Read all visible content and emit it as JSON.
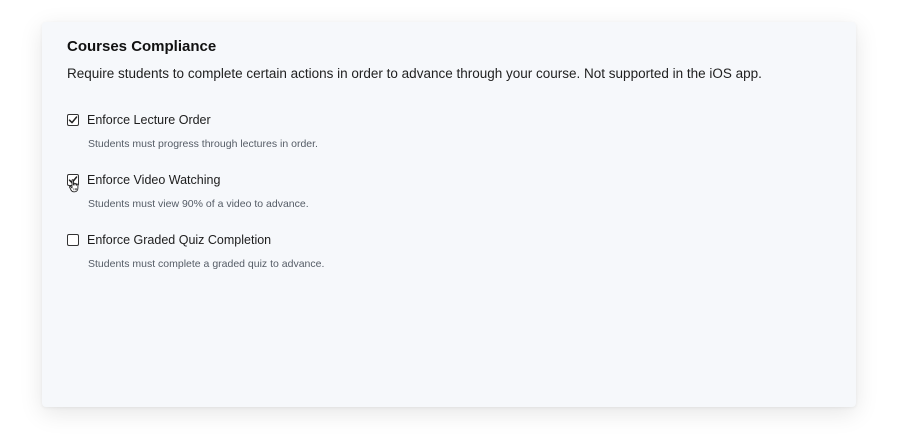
{
  "compliance": {
    "title": "Courses Compliance",
    "description": "Require students to complete certain actions in order to advance through your course. Not supported in the iOS app.",
    "options": [
      {
        "label": "Enforce Lecture Order",
        "help": "Students must progress through lectures in order.",
        "checked": true
      },
      {
        "label": "Enforce Video Watching",
        "help": "Students must view 90% of a video to advance.",
        "checked": true
      },
      {
        "label": "Enforce Graded Quiz Completion",
        "help": "Students must complete a graded quiz to advance.",
        "checked": false
      }
    ]
  },
  "icons": {
    "check": "checkmark-icon",
    "cursor": "hand-pointer-icon"
  }
}
